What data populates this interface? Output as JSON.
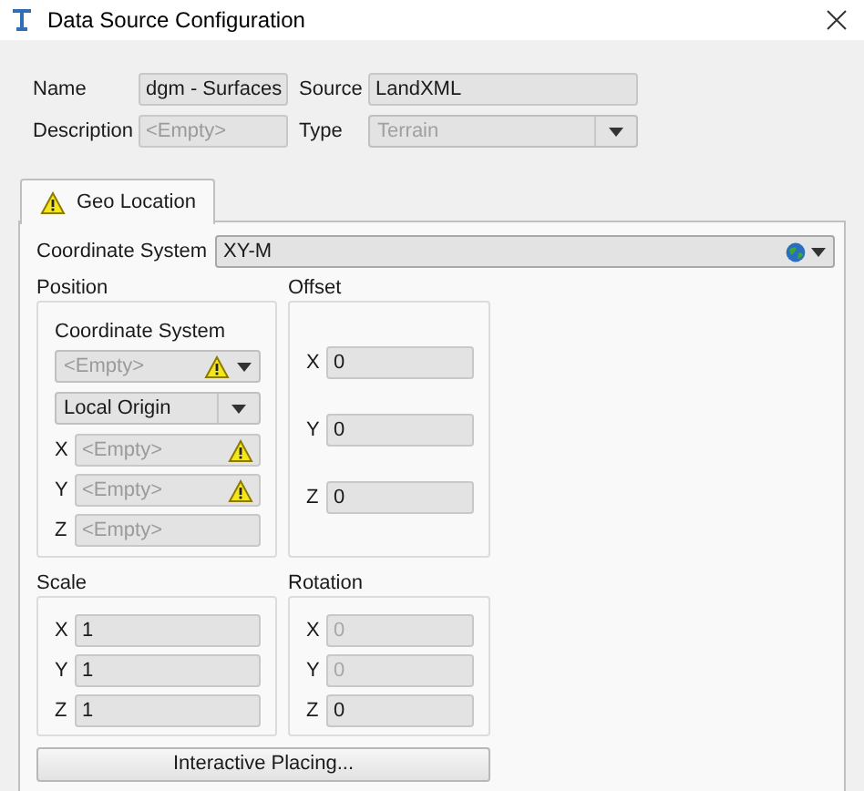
{
  "window": {
    "title": "Data Source Configuration"
  },
  "general": {
    "name": {
      "label": "Name",
      "value": "dgm - Surfaces"
    },
    "source": {
      "label": "Source",
      "value": "LandXML"
    },
    "description": {
      "label": "Description",
      "placeholder": "<Empty>"
    },
    "type": {
      "label": "Type",
      "value": "Terrain",
      "disabled": true
    }
  },
  "tabs": [
    {
      "label": "Geo Location",
      "selected": true,
      "warning": true
    }
  ],
  "coordinate_system": {
    "label": "Coordinate System",
    "value": "XY-M"
  },
  "position": {
    "title": "Position",
    "coordinate_system_label": "Coordinate System",
    "coordinate_system": {
      "placeholder": "<Empty>",
      "warning": true
    },
    "origin": {
      "value": "Local Origin"
    },
    "fields": [
      {
        "label": "X",
        "placeholder": "<Empty>",
        "warning": true
      },
      {
        "label": "Y",
        "placeholder": "<Empty>",
        "warning": true
      },
      {
        "label": "Z",
        "placeholder": "<Empty>",
        "warning": false
      }
    ]
  },
  "offset": {
    "title": "Offset",
    "fields": [
      {
        "label": "X",
        "value": "0",
        "disabled": false
      },
      {
        "label": "Y",
        "value": "0",
        "disabled": false
      },
      {
        "label": "Z",
        "value": "0",
        "disabled": false
      }
    ]
  },
  "scale": {
    "title": "Scale",
    "fields": [
      {
        "label": "X",
        "value": "1",
        "disabled": false
      },
      {
        "label": "Y",
        "value": "1",
        "disabled": false
      },
      {
        "label": "Z",
        "value": "1",
        "disabled": false
      }
    ]
  },
  "rotation": {
    "title": "Rotation",
    "fields": [
      {
        "label": "X",
        "value": "0",
        "disabled": true
      },
      {
        "label": "Y",
        "value": "0",
        "disabled": true
      },
      {
        "label": "Z",
        "value": "0",
        "disabled": false
      }
    ]
  },
  "button": {
    "label": "Interactive Placing..."
  }
}
